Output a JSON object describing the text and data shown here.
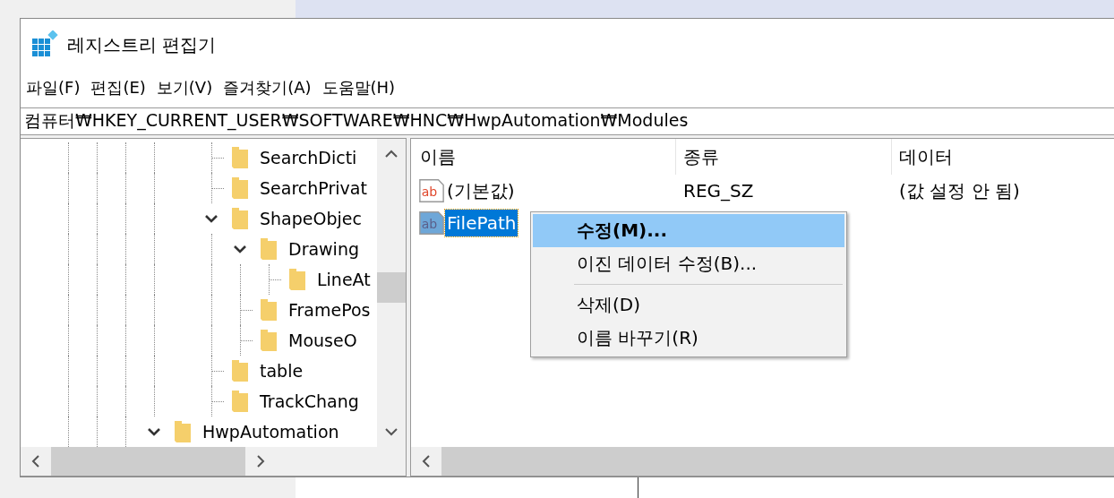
{
  "window": {
    "title": "레지스트리 편집기"
  },
  "menu_bar": [
    "파일(F)",
    "편집(E)",
    "보기(V)",
    "즐겨찾기(A)",
    "도움말(H)"
  ],
  "address": "컴퓨터₩HKEY_CURRENT_USER₩SOFTWARE₩HNC₩HwpAutomation₩Modules",
  "tree": {
    "items": [
      {
        "children": [
          {
            "children": [
              {
                "label": "SearchDicti"
              },
              {
                "label": "SearchPrivat"
              },
              {
                "label": "ShapeObjec",
                "expanded": true,
                "children": [
                  {
                    "label": "Drawing",
                    "expanded": true,
                    "children": [
                      {
                        "label": "LineAt"
                      }
                    ]
                  },
                  {
                    "label": "FramePos"
                  },
                  {
                    "label": "MouseO"
                  }
                ]
              },
              {
                "label": "table"
              },
              {
                "label": "TrackChang"
              }
            ]
          }
        ]
      },
      {
        "label": "HwpAutomation",
        "expanded": true
      }
    ]
  },
  "values": {
    "columns": [
      "이름",
      "종류",
      "데이터"
    ],
    "rows": [
      {
        "name": "(기본값)",
        "type": "REG_SZ",
        "data": "(값 설정 안 됨)",
        "icon_text": "ab",
        "selected": false
      },
      {
        "name": "FilePath",
        "icon_text": "ab",
        "selected": true
      }
    ]
  },
  "context_menu": {
    "items": [
      {
        "kind": "item",
        "label": "수정(M)...",
        "selected": true,
        "default": true
      },
      {
        "kind": "item",
        "label": "이진 데이터 수정(B)...",
        "selected": false,
        "default": false
      },
      {
        "kind": "separator"
      },
      {
        "kind": "item",
        "label": "삭제(D)",
        "selected": false,
        "default": false
      },
      {
        "kind": "item",
        "label": "이름 바꾸기(R)",
        "selected": false,
        "default": false
      }
    ]
  }
}
